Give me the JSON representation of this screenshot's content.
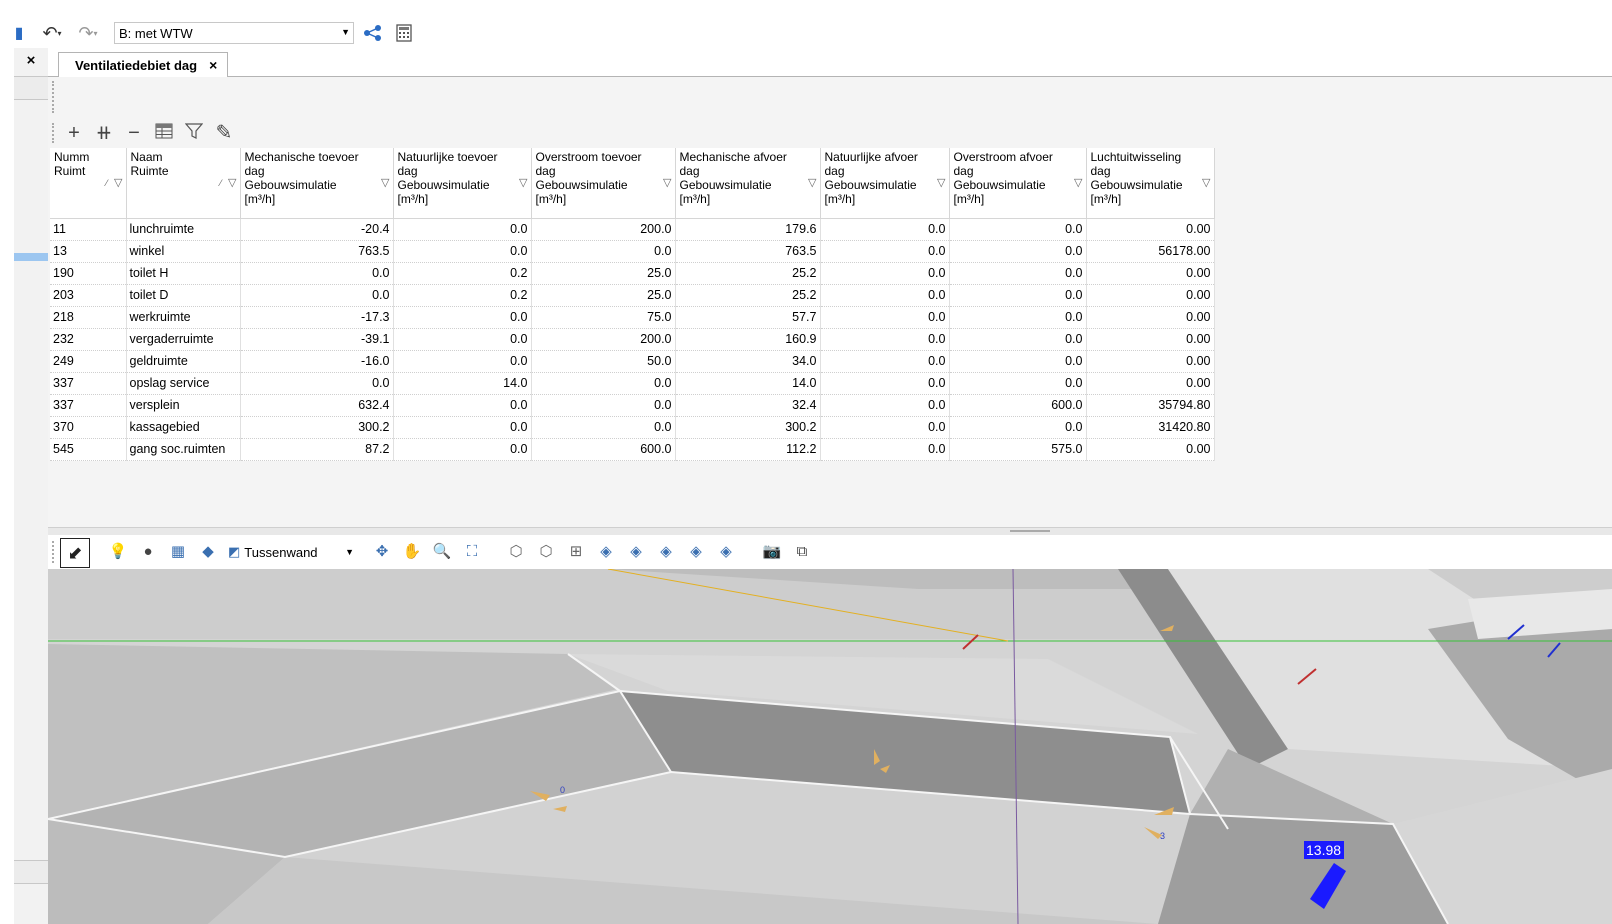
{
  "toolbar": {
    "scenario": "B: met WTW"
  },
  "tabs": [
    {
      "label": "Ventilatiedebiet dag",
      "close": "×"
    }
  ],
  "left_strip": {
    "close": "×"
  },
  "grid": {
    "columns": [
      {
        "line1": "Numm",
        "line2": "Ruimt",
        "line3": "",
        "line4": ""
      },
      {
        "line1": "Naam",
        "line2": "Ruimte",
        "line3": "",
        "line4": ""
      },
      {
        "line1": "Mechanische toevoer",
        "line2": "dag",
        "line3": "Gebouwsimulatie",
        "line4": "[m³/h]"
      },
      {
        "line1": "Natuurlijke toevoer",
        "line2": "dag",
        "line3": "Gebouwsimulatie",
        "line4": "[m³/h]"
      },
      {
        "line1": "Overstroom toevoer",
        "line2": "dag",
        "line3": "Gebouwsimulatie",
        "line4": "[m³/h]"
      },
      {
        "line1": "Mechanische afvoer",
        "line2": "dag",
        "line3": "Gebouwsimulatie",
        "line4": "[m³/h]"
      },
      {
        "line1": "Natuurlijke afvoer",
        "line2": "dag",
        "line3": "Gebouwsimulatie",
        "line4": "[m³/h]"
      },
      {
        "line1": "Overstroom afvoer",
        "line2": "dag",
        "line3": "Gebouwsimulatie",
        "line4": "[m³/h]"
      },
      {
        "line1": "Luchtuitwisseling",
        "line2": "dag",
        "line3": "Gebouwsimulatie",
        "line4": "[m³/h]"
      }
    ],
    "rows": [
      [
        "11",
        "lunchruimte",
        "-20.4",
        "0.0",
        "200.0",
        "179.6",
        "0.0",
        "0.0",
        "0.00"
      ],
      [
        "13",
        "winkel",
        "763.5",
        "0.0",
        "0.0",
        "763.5",
        "0.0",
        "0.0",
        "56178.00"
      ],
      [
        "190",
        "toilet H",
        "0.0",
        "0.2",
        "25.0",
        "25.2",
        "0.0",
        "0.0",
        "0.00"
      ],
      [
        "203",
        "toilet D",
        "0.0",
        "0.2",
        "25.0",
        "25.2",
        "0.0",
        "0.0",
        "0.00"
      ],
      [
        "218",
        "werkruimte",
        "-17.3",
        "0.0",
        "75.0",
        "57.7",
        "0.0",
        "0.0",
        "0.00"
      ],
      [
        "232",
        "vergaderruimte",
        "-39.1",
        "0.0",
        "200.0",
        "160.9",
        "0.0",
        "0.0",
        "0.00"
      ],
      [
        "249",
        "geldruimte",
        "-16.0",
        "0.0",
        "50.0",
        "34.0",
        "0.0",
        "0.0",
        "0.00"
      ],
      [
        "337",
        "opslag service",
        "0.0",
        "14.0",
        "0.0",
        "14.0",
        "0.0",
        "0.0",
        "0.00"
      ],
      [
        "337",
        "versplein",
        "632.4",
        "0.0",
        "0.0",
        "32.4",
        "0.0",
        "600.0",
        "35794.80"
      ],
      [
        "370",
        "kassagebied",
        "300.2",
        "0.0",
        "0.0",
        "300.2",
        "0.0",
        "0.0",
        "31420.80"
      ],
      [
        "545",
        "gang soc.ruimten",
        "87.2",
        "0.0",
        "600.0",
        "112.2",
        "0.0",
        "575.0",
        "0.00"
      ]
    ]
  },
  "view_toolbar": {
    "element_type": "Tussenwand"
  },
  "viewport": {
    "labels": {
      "value_tag": "13.98",
      "marker_0": "0",
      "marker_3": "3"
    }
  },
  "colors": {
    "value_tag_bg": "#1a1aff",
    "wall_dark": "#8a8a8a",
    "floor": "#d0d0d0"
  }
}
